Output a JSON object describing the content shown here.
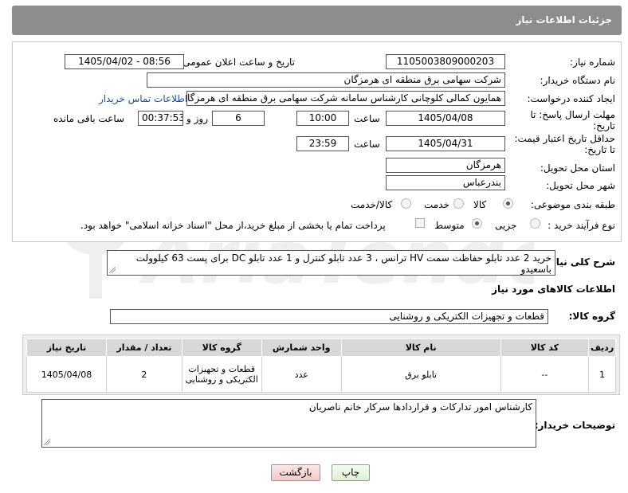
{
  "header": {
    "title": "جزئیات اطلاعات نیاز"
  },
  "form": {
    "need_number": {
      "label": "شماره نیاز:",
      "value": "1105003809000203"
    },
    "announce": {
      "label": "تاریخ و ساعت اعلان عمومی:",
      "value": "1405/04/02 - 08:56"
    },
    "buyer_org": {
      "label": "نام دستگاه خریدار:",
      "value": "شرکت سهامی برق منطقه ای هرمزگان"
    },
    "creator": {
      "label": "ایجاد کننده درخواست:",
      "value": "همایون کمالی کلوچانی کارشناس سامانه شرکت سهامی برق منطقه ای هرمزگان",
      "contact_link": "اطلاعات تماس خریدار"
    },
    "reply_deadline": {
      "label_line1": "مهلت ارسال پاسخ: تا",
      "label_line2": "تاریخ:",
      "date": "1405/04/08",
      "time_label": "ساعت",
      "time": "10:00",
      "days": "6",
      "days_label": "روز و",
      "remaining": "00:37:53",
      "remaining_label": "ساعت باقی مانده"
    },
    "price_validity": {
      "label_line1": "حداقل تاریخ اعتبار قیمت:",
      "label_line2": "تا تاریخ:",
      "date": "1405/04/31",
      "time_label": "ساعت",
      "time": "23:59"
    },
    "province": {
      "label": "استان محل تحویل:",
      "value": "هرمزگان"
    },
    "city": {
      "label": "شهر محل تحویل:",
      "value": "بندرعباس"
    },
    "category": {
      "label": "طبقه بندی موضوعی:",
      "options": [
        "کالا",
        "خدمت",
        "کالا/خدمت"
      ],
      "selected": "کالا"
    },
    "process": {
      "label": "نوع فرآیند خرید :",
      "options": [
        "جزیی",
        "متوسط"
      ],
      "selected": "متوسط",
      "payment_note": "پرداخت تمام یا بخشی از مبلغ خرید،از محل \"اسناد خزانه اسلامی\" خواهد بود."
    }
  },
  "summary": {
    "label": "شرح کلی نیاز:",
    "value": "خرید 2 عدد تابلو حفاظت سمت HV ترانس ، 3 عدد تابلو کنترل و 1 عدد تابلو DC برای پست 63 کیلوولت باسعیدو"
  },
  "goods_info": {
    "title": "اطلاعات کالاهای مورد نیاز",
    "group_label": "گروه کالا:",
    "group_value": "قطعات و تجهیزات الکتریکی و روشنایی"
  },
  "table": {
    "headers": [
      "ردیف",
      "کد کالا",
      "نام کالا",
      "واحد شمارش",
      "گروه کالا",
      "تعداد / مقدار",
      "تاریخ نیاز"
    ],
    "rows": [
      {
        "row": "1",
        "code": "--",
        "name": "تابلو برق",
        "unit": "عدد",
        "group": "قطعات و تجهیزات الکتریکی و روشنایی",
        "qty": "2",
        "date": "1405/04/08"
      }
    ]
  },
  "buyer_notes": {
    "label": "توضیحات خریدار:",
    "value": "کارشناس امور تدارکات و قراردادها سرکار خانم ناصریان"
  },
  "buttons": {
    "print": "چاپ",
    "back": "بازگشت"
  },
  "colors": {
    "header_bg": "#8d8d8d",
    "link": "#1a4fa0",
    "back_button_bg": "#f7d4d4",
    "print_button_bg": "#e8f5e0"
  },
  "watermark": {
    "text": "AriaTender.neT"
  }
}
